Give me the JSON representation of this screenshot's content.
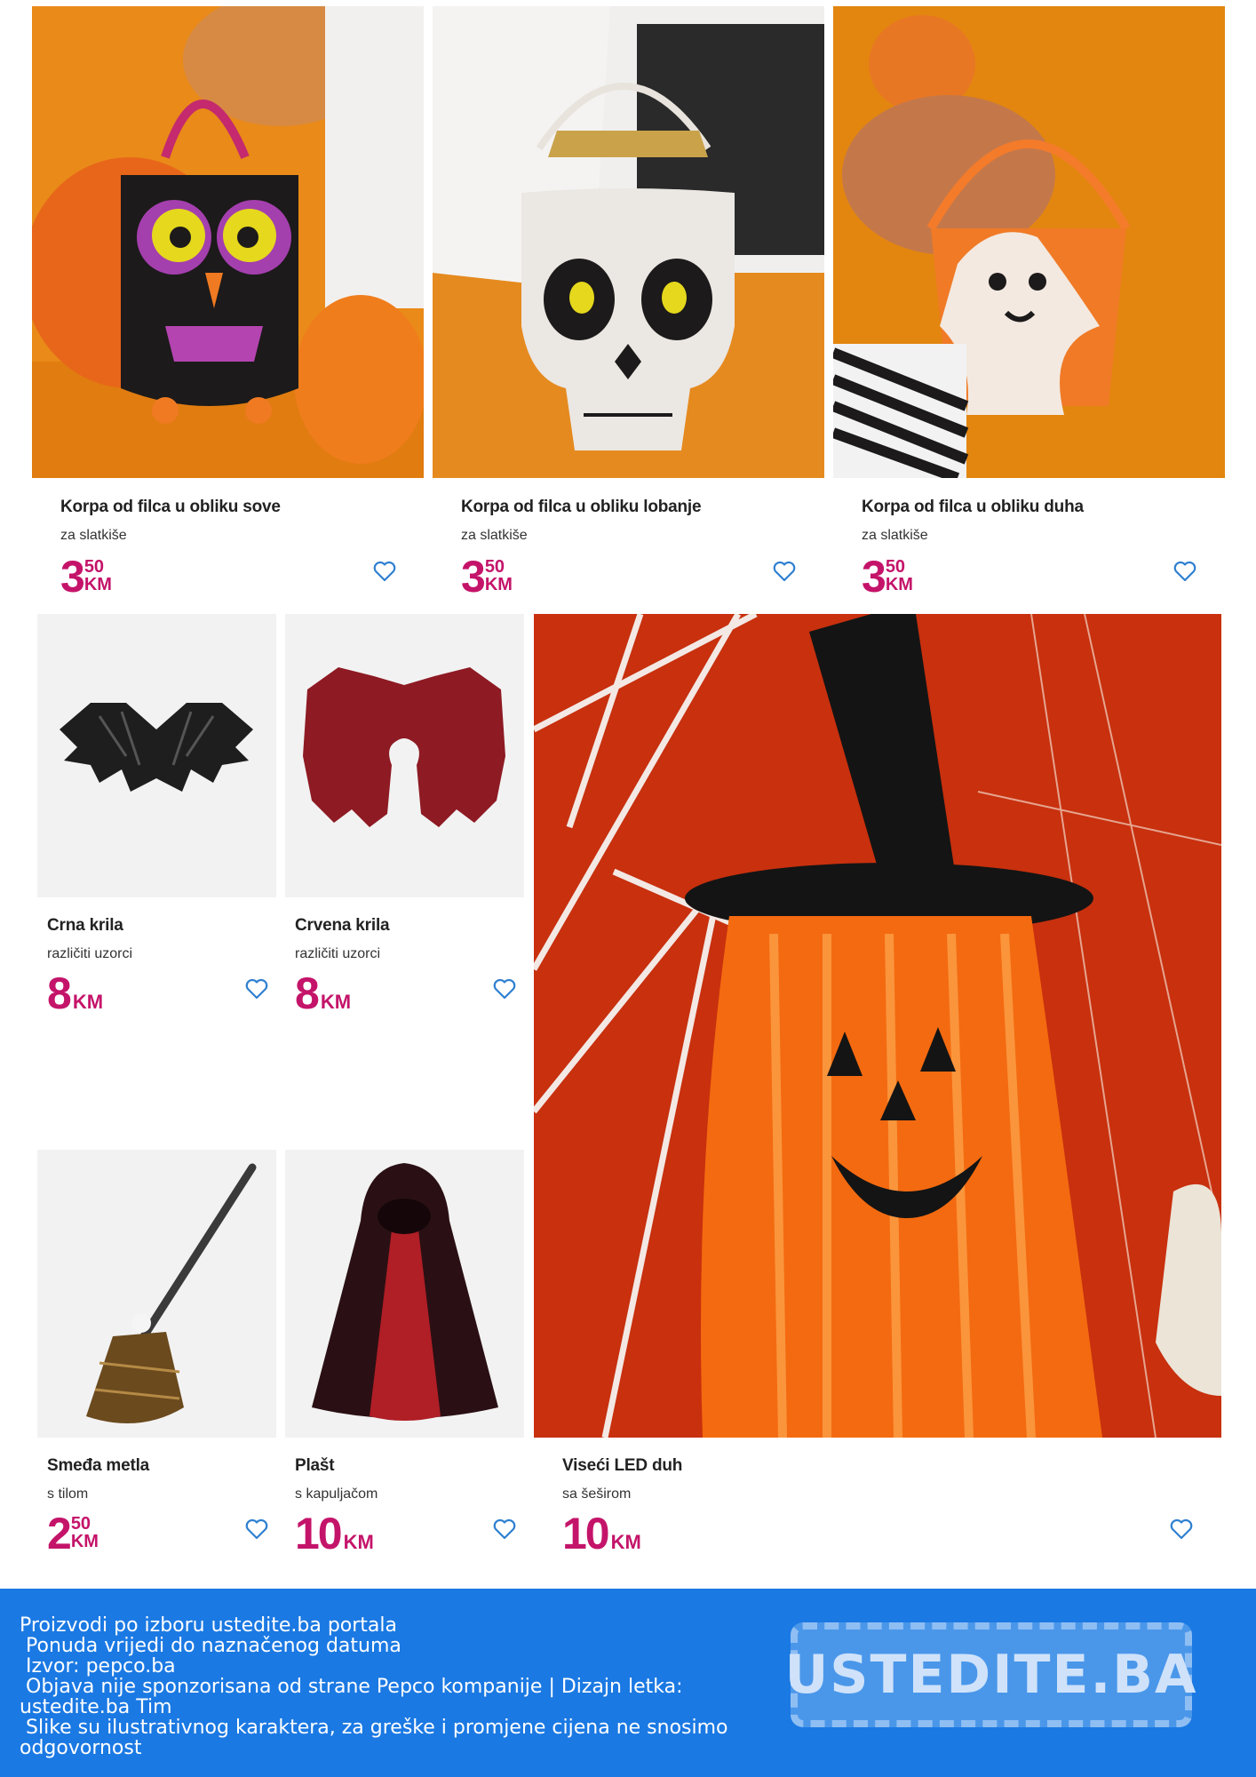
{
  "products": [
    {
      "name": "Korpa od filca u obliku sove",
      "sub": "za slatkiše",
      "price_int": "3",
      "price_cents": "50",
      "currency": "KM",
      "image": "owl-felt-basket"
    },
    {
      "name": "Korpa od filca u obliku lobanje",
      "sub": "za slatkiše",
      "price_int": "3",
      "price_cents": "50",
      "currency": "KM",
      "image": "skull-felt-basket"
    },
    {
      "name": "Korpa od filca u obliku duha",
      "sub": "za slatkiše",
      "price_int": "3",
      "price_cents": "50",
      "currency": "KM",
      "image": "ghost-felt-basket"
    },
    {
      "name": "Crna krila",
      "sub": "različiti uzorci",
      "price_int": "8",
      "price_cents": "",
      "currency": "KM",
      "image": "black-bat-wings"
    },
    {
      "name": "Crvena krila",
      "sub": "različiti uzorci",
      "price_int": "8",
      "price_cents": "",
      "currency": "KM",
      "image": "red-wings"
    },
    {
      "name": "Smeđa metla",
      "sub": "s tilom",
      "price_int": "2",
      "price_cents": "50",
      "currency": "KM",
      "image": "brown-broom"
    },
    {
      "name": "Plašt",
      "sub": "s kapuljačom",
      "price_int": "10",
      "price_cents": "",
      "currency": "KM",
      "image": "hooded-cape"
    },
    {
      "name": "Viseći LED duh",
      "sub": "sa šeširom",
      "price_int": "10",
      "price_cents": "",
      "currency": "KM",
      "image": "hanging-led-ghost"
    }
  ],
  "footer": {
    "lines": [
      "Proizvodi po izboru ustedite.ba portala",
      " Ponuda vrijedi do naznačenog datuma",
      " Izvor: pepco.ba",
      " Objava nije sponzorisana od strane Pepco kompanije | Dizajn letka: ustedite.ba Tim",
      " Slike su ilustrativnog karaktera, za greške i promjene cijena ne snosimo odgovornost"
    ],
    "logo_text": "USTEDITE.BA"
  },
  "colors": {
    "price": "#c4146a",
    "heart": "#2e7fd0",
    "footer_bg": "#1b79e3"
  },
  "icons": {
    "wishlist": "heart-outline-icon"
  }
}
